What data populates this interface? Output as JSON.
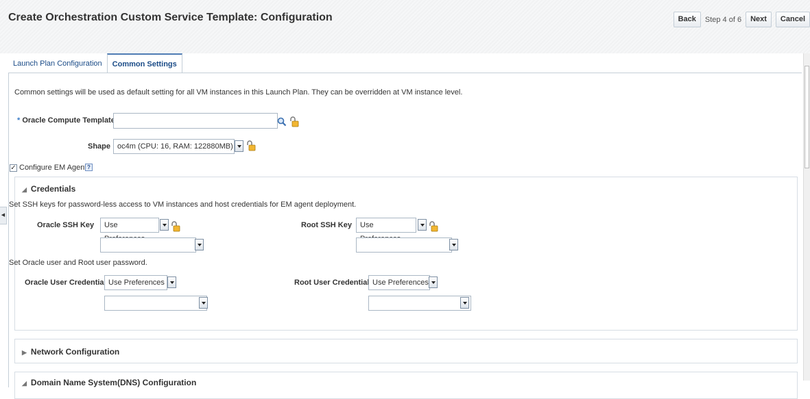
{
  "page": {
    "title": "Create Orchestration Custom Service Template: Configuration"
  },
  "train": {
    "back_label": "Back",
    "step_text": "Step 4 of 6",
    "next_label": "Next",
    "cancel_label": "Cancel"
  },
  "tabs": [
    {
      "label": "Launch Plan Configuration",
      "active": false
    },
    {
      "label": "Common Settings",
      "active": true
    }
  ],
  "common": {
    "intro": "Common settings will be used as default setting for all VM instances in this Launch Plan. They can be overridden at VM instance level.",
    "compute_template_label": "Oracle Compute Template",
    "compute_template_required_mark": "*",
    "compute_template_value": "",
    "shape_label": "Shape",
    "shape_value": "oc4m (CPU: 16, RAM: 122880MB)",
    "configure_em_label": "Configure EM Agent",
    "configure_em_checked": true
  },
  "credentials": {
    "title": "Credentials",
    "ssh_intro": "Set SSH keys for password-less access to VM instances and host credentials for EM agent deployment.",
    "oracle_ssh_label": "Oracle SSH Key",
    "oracle_ssh_value": "Use Preferences",
    "root_ssh_label": "Root SSH Key",
    "root_ssh_value": "Use Preferences",
    "password_intro": "Set Oracle user and Root user password.",
    "oracle_user_label": "Oracle User Credential",
    "oracle_user_value": "Use Preferences",
    "root_user_label": "Root User Credential",
    "root_user_value": "Use Preferences"
  },
  "sections": {
    "network": "Network Configuration",
    "dns": "Domain Name System(DNS) Configuration"
  },
  "icons": {
    "search": "search-icon",
    "lock": "lock-icon",
    "help": "help-icon",
    "expand": "triangle-right-icon",
    "collapse": "triangle-down-icon"
  },
  "colors": {
    "link": "#1a4b87",
    "tab_accent": "#4f7cb4",
    "required": "#3b7bc7"
  }
}
